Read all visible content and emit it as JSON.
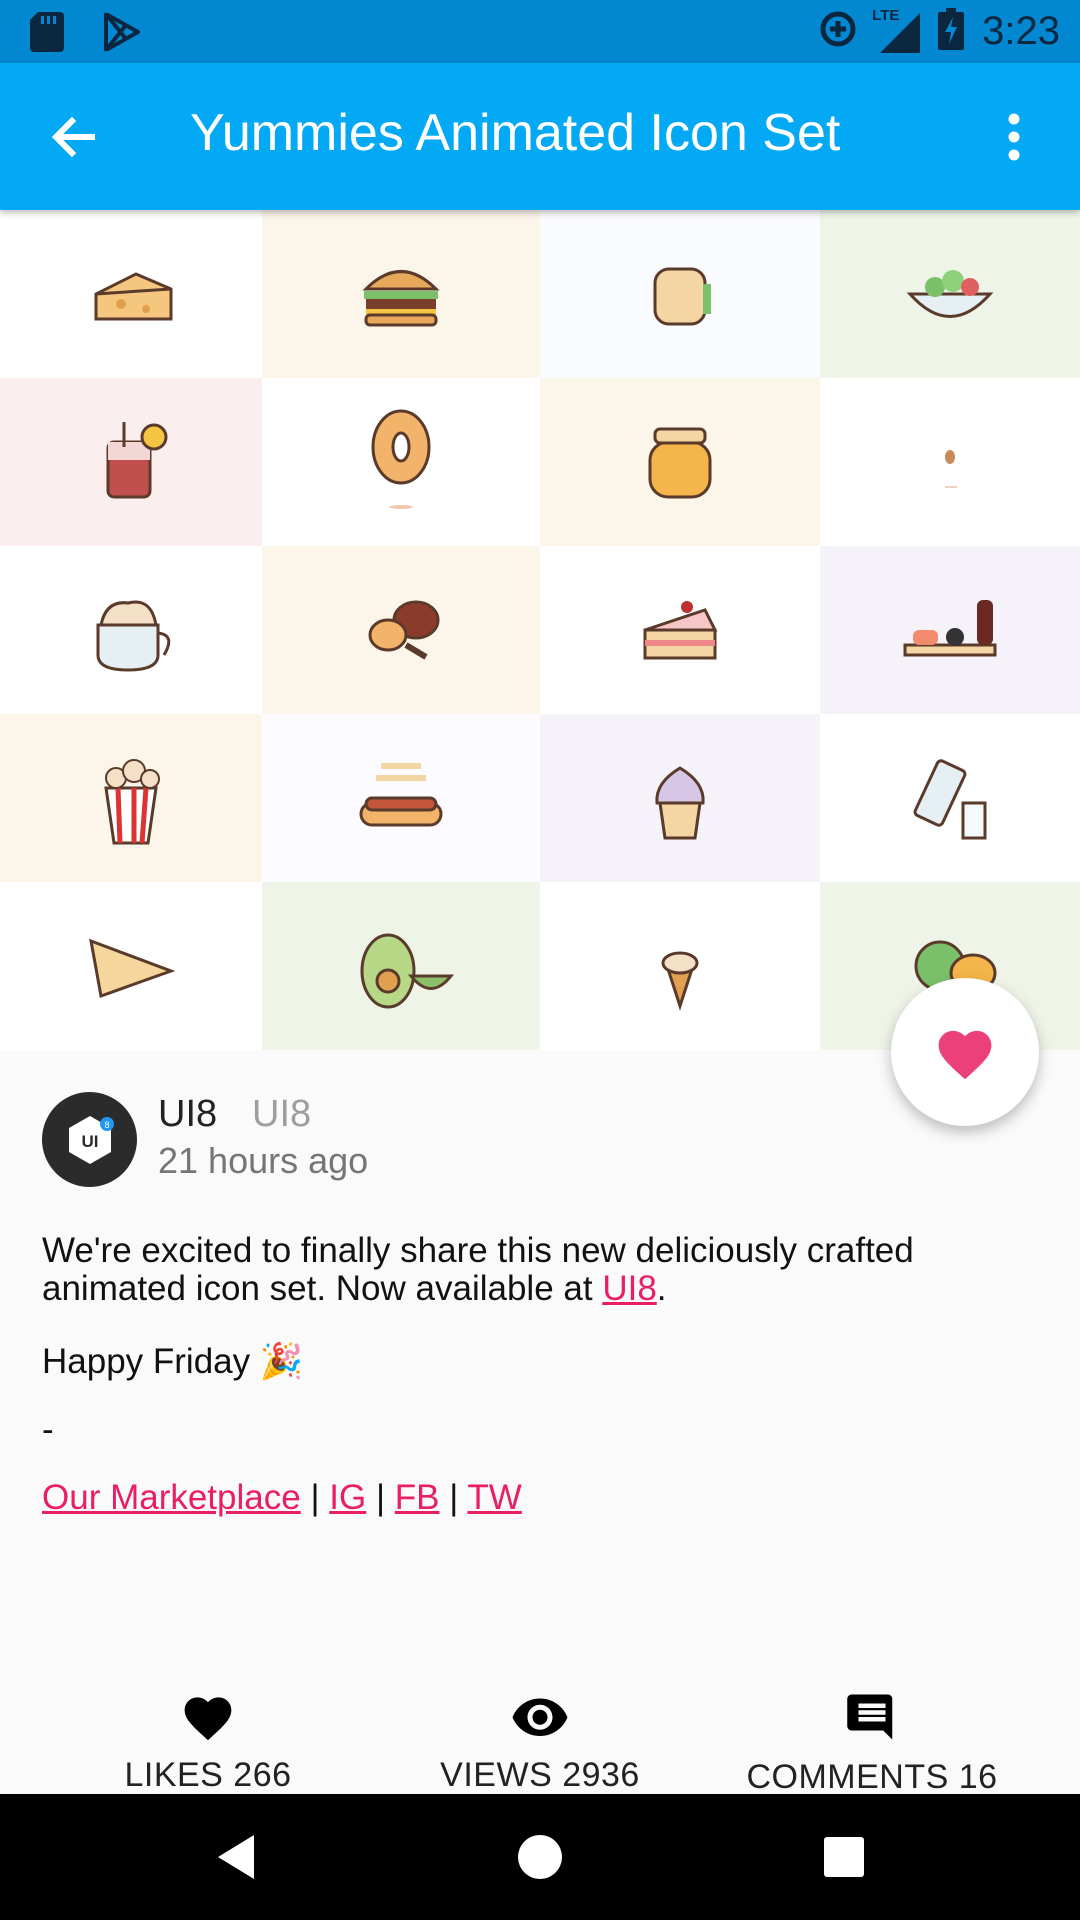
{
  "status_bar": {
    "time": "3:23",
    "network": "LTE",
    "icons": [
      "sd-card-icon",
      "play-store-icon",
      "data-saver-icon",
      "signal-icon",
      "battery-icon"
    ]
  },
  "app_bar": {
    "title": "Yummies Animated Icon Set",
    "back_icon": "arrow-back-icon",
    "more_icon": "more-vert-icon"
  },
  "preview": {
    "cells": [
      {
        "name": "cheese",
        "bg": "#ffffff"
      },
      {
        "name": "burger",
        "bg": "#fbf5ea"
      },
      {
        "name": "sandwich",
        "bg": "#fafbff"
      },
      {
        "name": "salad",
        "bg": "#eef5e8"
      },
      {
        "name": "lemonade-jar",
        "bg": "#fbeeee"
      },
      {
        "name": "donut",
        "bg": "#ffffff"
      },
      {
        "name": "honey-jar",
        "bg": "#fbf5ea"
      },
      {
        "name": "coffee-bean",
        "bg": "#ffffff"
      },
      {
        "name": "cappuccino",
        "bg": "#ffffff"
      },
      {
        "name": "chicken-legs",
        "bg": "#fbf5ea"
      },
      {
        "name": "cake-slice",
        "bg": "#ffffff"
      },
      {
        "name": "sushi",
        "bg": "#f6f2f9"
      },
      {
        "name": "popcorn",
        "bg": "#fbf5ea"
      },
      {
        "name": "hot-dog",
        "bg": "#fcfbff"
      },
      {
        "name": "ice-cream-cup",
        "bg": "#f6f2f9"
      },
      {
        "name": "milk-bottle",
        "bg": "#ffffff"
      },
      {
        "name": "cheese-wedge",
        "bg": "#ffffff"
      },
      {
        "name": "avocado",
        "bg": "#eef5e8"
      },
      {
        "name": "ice-cream-cone",
        "bg": "#ffffff"
      },
      {
        "name": "apple-orange",
        "bg": "#eef5e8"
      }
    ]
  },
  "fab": {
    "icon": "heart-icon",
    "color": "#ec407a"
  },
  "author": {
    "name": "UI8",
    "handle": "UI8",
    "time": "21 hours ago",
    "avatar_text": "UI",
    "avatar_badge": "8"
  },
  "post": {
    "line1_before": "We're excited to finally share this new deliciously crafted animated icon set. Now available at ",
    "line1_link": "UI8",
    "line1_after": ".",
    "line2": "Happy Friday 🎉",
    "line3": "-",
    "links": [
      "Our Marketplace",
      "IG",
      "FB",
      "TW"
    ],
    "separator": " | ",
    "link_color": "#e91e63"
  },
  "stats": {
    "likes": "LIKES 266",
    "views": "VIEWS 2936",
    "comments": "COMMENTS 16"
  },
  "colors": {
    "status_bar": "#0288d1",
    "app_bar": "#03a9f4"
  }
}
